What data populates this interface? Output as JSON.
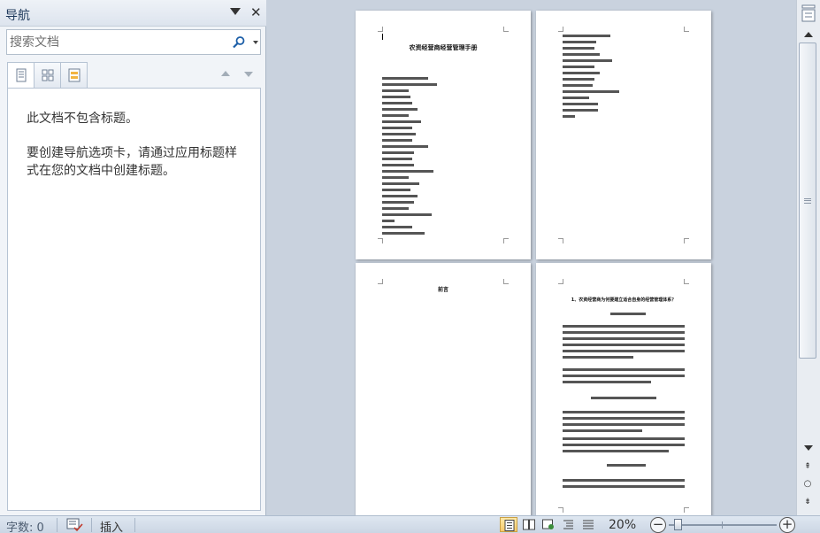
{
  "nav_pane": {
    "title": "导航",
    "search_placeholder": "搜索文档",
    "no_headings_message": "此文档不包含标题。",
    "create_headings_hint": "要创建导航选项卡，请通过应用标题样式在您的文档中创建标题。"
  },
  "document": {
    "pages": [
      {
        "title": "农资经营商经营管理手册"
      },
      {
        "title": ""
      },
      {
        "title": "前言"
      },
      {
        "title": "1、农资经营商为何要建立适合自身的经营管理体系？"
      }
    ]
  },
  "status_bar": {
    "word_count": "字数: 0",
    "insert_mode": "插入",
    "zoom_level": "20%"
  },
  "icons": {
    "nav_menu": "dropdown-arrow-icon",
    "nav_close": "close-icon",
    "search": "magnifier-icon",
    "tab_headings": "document-outline-icon",
    "tab_pages": "thumbnails-icon",
    "tab_results": "search-results-icon",
    "proofing": "proofing-check-icon",
    "zoom_out": "minus-icon",
    "zoom_in": "plus-icon"
  },
  "colors": {
    "accent_nav_title": "#1e395b",
    "doc_background": "#c9d2de",
    "active_view_button": "#f7c96a"
  }
}
